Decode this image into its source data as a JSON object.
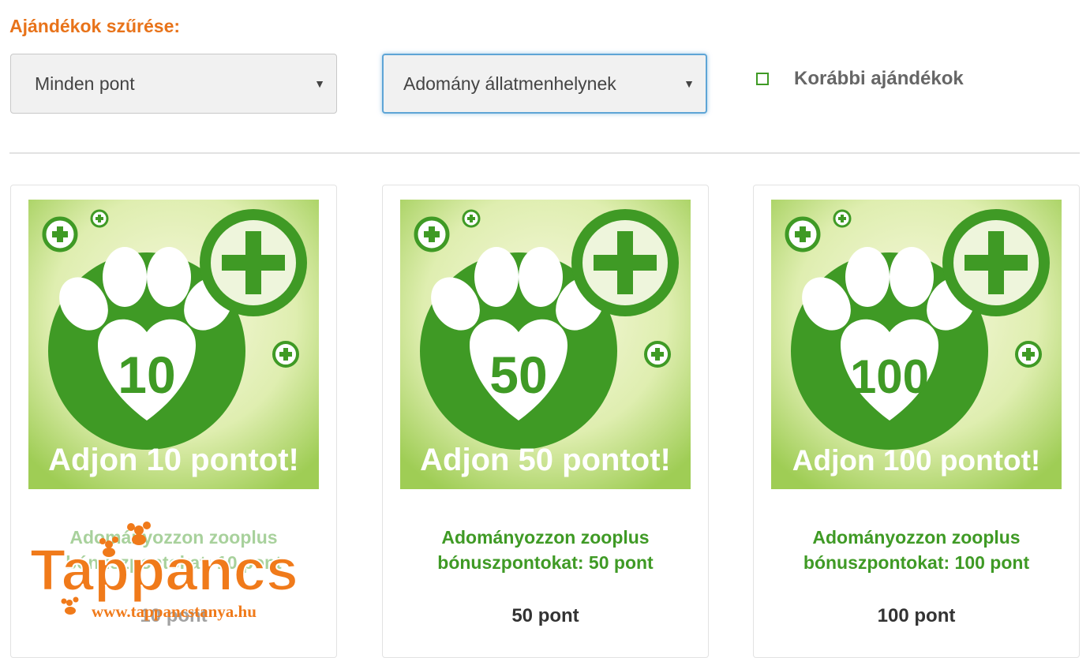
{
  "filter": {
    "title": "Ajándékok szűrése:",
    "points_select": "Minden pont",
    "category_select": "Adomány állatmenhelynek",
    "previous_gifts_label": "Korábbi ajándékok"
  },
  "colors": {
    "accent_orange": "#e8731a",
    "brand_green": "#3f9a25",
    "focus_blue": "#5ea5d6"
  },
  "cards": [
    {
      "badge_number": "10",
      "banner": "Adjon 10 pontot!",
      "name": "Adományozzon zooplus bónuszpontokat: 10 pont",
      "price": "10 pont"
    },
    {
      "badge_number": "50",
      "banner": "Adjon 50 pontot!",
      "name": "Adományozzon zooplus bónuszpontokat: 50 pont",
      "price": "50 pont"
    },
    {
      "badge_number": "100",
      "banner": "Adjon 100 pontot!",
      "name": "Adományozzon zooplus bónuszpontokat: 100 pont",
      "price": "100 pont"
    }
  ],
  "watermark": {
    "logo_text": "Tappancs",
    "url": "www.tappancstanya.hu"
  }
}
